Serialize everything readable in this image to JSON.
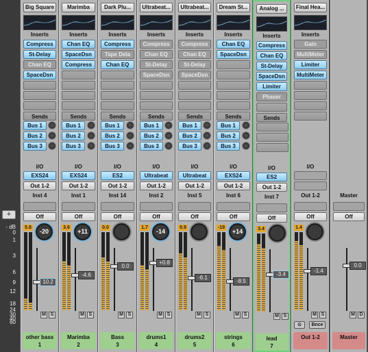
{
  "scale": {
    "db_label": "dB",
    "ticks": [
      "0",
      "1",
      "3",
      "6",
      "9",
      "12",
      "18",
      "24",
      "30",
      "40",
      "60"
    ],
    "add_label": "+"
  },
  "labels": {
    "inserts": "Inserts",
    "sends": "Sends",
    "io": "I/O"
  },
  "channels": [
    {
      "instrument": "Big Square",
      "inserts": [
        {
          "name": "Compress",
          "state": "on"
        },
        {
          "name": "St-Delay",
          "state": "on"
        },
        {
          "name": "Chan EQ",
          "state": "bypass"
        },
        {
          "name": "SpaceDsn",
          "state": "on"
        }
      ],
      "sends": [
        "Bus 1",
        "Bus 2",
        "Bus 3"
      ],
      "input": "EXS24",
      "output": "Out 1-2",
      "track_label": "Inst 4",
      "automation": "Off",
      "peak": "5.8",
      "pan": "-20",
      "fader": "10.2",
      "meter": 0.15,
      "name": "other bass",
      "number": "1"
    },
    {
      "instrument": "Marimba",
      "inserts": [
        {
          "name": "Chan EQ",
          "state": "on"
        },
        {
          "name": "SpaceDsn",
          "state": "on"
        },
        {
          "name": "Compress",
          "state": "on"
        }
      ],
      "sends": [
        "Bus 1",
        "Bus 2",
        "Bus 3"
      ],
      "input": "EXS24",
      "output": "Out 1-2",
      "track_label": "Inst 1",
      "automation": "Off",
      "peak": "3.6",
      "pan": "+11",
      "fader": "-4.6",
      "meter": 0.65,
      "name": "Marimba",
      "number": "2"
    },
    {
      "instrument": "Dark Plu...",
      "inserts": [
        {
          "name": "Compress",
          "state": "on"
        },
        {
          "name": "Tape Dela",
          "state": "bypass"
        },
        {
          "name": "Chan EQ",
          "state": "on"
        }
      ],
      "sends": [
        "Bus 1",
        "Bus 2",
        "Bus 3"
      ],
      "input": "ES2",
      "output": "Out 1-2",
      "track_label": "Inst 14",
      "automation": "Off",
      "peak": "0.0",
      "pan": "",
      "fader": "0.0",
      "meter": 0.7,
      "name": "Bass",
      "number": "3"
    },
    {
      "instrument": "Ultrabeat...",
      "inserts": [
        {
          "name": "Compress",
          "state": "bypass"
        },
        {
          "name": "Chan EQ",
          "state": "bypass"
        },
        {
          "name": "St-Delay",
          "state": "bypass"
        },
        {
          "name": "SpaceDsn",
          "state": "bypass"
        }
      ],
      "sends": [
        "Bus 1",
        "Bus 2",
        "Bus 3"
      ],
      "input": "Ultrabeat",
      "output": "Out 1-2",
      "track_label": "Inst 2",
      "automation": "Off",
      "peak": "1.7",
      "pan": "-14",
      "fader": "+0.8",
      "meter": 0.6,
      "name": "drums1",
      "number": "4"
    },
    {
      "instrument": "Ultrabeat...",
      "inserts": [
        {
          "name": "Compress",
          "state": "bypass"
        },
        {
          "name": "Chan EQ",
          "state": "bypass"
        },
        {
          "name": "St-Delay",
          "state": "bypass"
        },
        {
          "name": "SpaceDsn",
          "state": "bypass"
        }
      ],
      "sends": [
        "Bus 1",
        "Bus 2",
        "Bus 3"
      ],
      "input": "Ultrabeat",
      "output": "Out 1-2",
      "track_label": "Inst 5",
      "automation": "Off",
      "peak": "0.9",
      "pan": "",
      "fader": "-6.1",
      "meter": 0.75,
      "name": "drums2",
      "number": "5"
    },
    {
      "instrument": "Dream St...",
      "inserts": [
        {
          "name": "Chan EQ",
          "state": "on"
        },
        {
          "name": "SpaceDsn",
          "state": "on"
        }
      ],
      "sends": [
        "Bus 1",
        "Bus 2",
        "Bus 3"
      ],
      "input": "EXS24",
      "output": "Out 1-2",
      "track_label": "Inst 6",
      "automation": "Off",
      "peak": "-19",
      "pan": "+14",
      "fader": "-8.5",
      "meter": 0.85,
      "name": "strings",
      "number": "6"
    },
    {
      "instrument": "Analog ...",
      "inserts": [
        {
          "name": "Compress",
          "state": "on"
        },
        {
          "name": "Chan EQ",
          "state": "on"
        },
        {
          "name": "St-Delay",
          "state": "on"
        },
        {
          "name": "SpaceDsn",
          "state": "on"
        },
        {
          "name": "Limiter",
          "state": "on"
        },
        {
          "name": "Phaser",
          "state": "bypass"
        }
      ],
      "sends": [
        "",
        "",
        ""
      ],
      "input": "ES2",
      "output": "Out 1-2",
      "track_label": "Inst 7",
      "automation": "Off",
      "peak": "3.4",
      "pan": "",
      "fader": "-3.4",
      "meter": 0.9,
      "name": "lead",
      "number": "7"
    },
    {
      "instrument": "Final Hea...",
      "inserts": [
        {
          "name": "Gain",
          "state": "bypass"
        },
        {
          "name": "MultiMeter",
          "state": "bypass"
        },
        {
          "name": "Limiter",
          "state": "on"
        },
        {
          "name": "MultiMeter",
          "state": "on"
        }
      ],
      "sends": [],
      "input": "",
      "output": "",
      "track_label": "Out 1-2",
      "automation": "Off",
      "peak": "1.4",
      "pan": "",
      "fader": "-1.4",
      "meter": 0.92,
      "name": "Out 1-2",
      "number": "",
      "link_label": "Bnce"
    },
    {
      "instrument": "",
      "inserts": [],
      "sends": [],
      "input": "",
      "output": "",
      "track_label": "Master",
      "automation": "Off",
      "peak": "",
      "pan": "",
      "fader": "0.0",
      "meter": 0,
      "name": "Master",
      "number": ""
    }
  ]
}
